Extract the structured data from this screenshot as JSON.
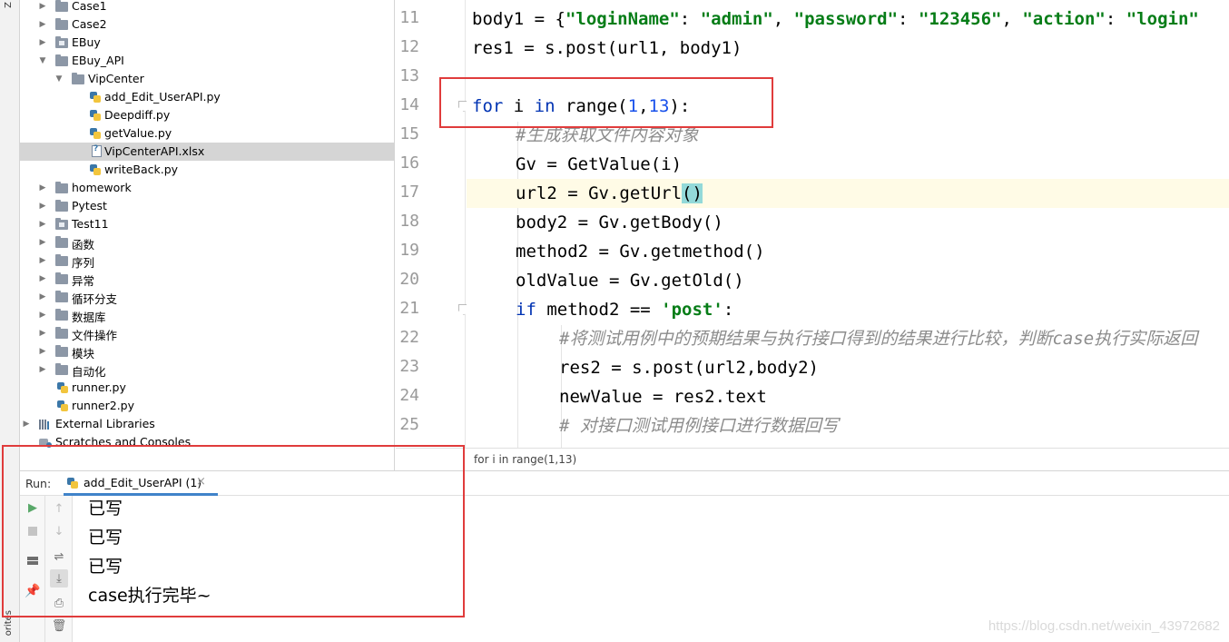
{
  "sidebar_strip": {
    "top_label": "Z",
    "bottom_label": "orites"
  },
  "project_tree": {
    "items": [
      {
        "label": "Case1",
        "type": "folder",
        "expanded": false,
        "depth": 1
      },
      {
        "label": "Case2",
        "type": "folder",
        "expanded": false,
        "depth": 1
      },
      {
        "label": "EBuy",
        "type": "package",
        "expanded": false,
        "depth": 1
      },
      {
        "label": "EBuy_API",
        "type": "folder",
        "expanded": true,
        "depth": 1
      },
      {
        "label": "VipCenter",
        "type": "folder",
        "expanded": true,
        "depth": 2
      },
      {
        "label": "add_Edit_UserAPI.py",
        "type": "python",
        "depth": 3
      },
      {
        "label": "Deepdiff.py",
        "type": "python",
        "depth": 3
      },
      {
        "label": "getValue.py",
        "type": "python",
        "depth": 3
      },
      {
        "label": "VipCenterAPI.xlsx",
        "type": "xlsx",
        "depth": 3,
        "selected": true
      },
      {
        "label": "writeBack.py",
        "type": "python",
        "depth": 3
      },
      {
        "label": "homework",
        "type": "folder",
        "expanded": false,
        "depth": 1
      },
      {
        "label": "Pytest",
        "type": "folder",
        "expanded": false,
        "depth": 1
      },
      {
        "label": "Test11",
        "type": "package",
        "expanded": false,
        "depth": 1
      },
      {
        "label": "函数",
        "type": "folder",
        "expanded": false,
        "depth": 1
      },
      {
        "label": "序列",
        "type": "folder",
        "expanded": false,
        "depth": 1
      },
      {
        "label": "异常",
        "type": "folder",
        "expanded": false,
        "depth": 1
      },
      {
        "label": "循环分支",
        "type": "folder",
        "expanded": false,
        "depth": 1
      },
      {
        "label": "数据库",
        "type": "folder",
        "expanded": false,
        "depth": 1
      },
      {
        "label": "文件操作",
        "type": "folder",
        "expanded": false,
        "depth": 1
      },
      {
        "label": "模块",
        "type": "folder",
        "expanded": false,
        "depth": 1
      },
      {
        "label": "自动化",
        "type": "folder",
        "expanded": false,
        "depth": 1
      },
      {
        "label": "runner.py",
        "type": "python",
        "depth": 1
      },
      {
        "label": "runner2.py",
        "type": "python",
        "depth": 1
      },
      {
        "label": "External Libraries",
        "type": "library",
        "expanded": false,
        "depth": 0
      },
      {
        "label": "Scratches and Consoles",
        "type": "scratch",
        "depth": 0
      }
    ]
  },
  "editor": {
    "line_numbers": [
      "11",
      "12",
      "13",
      "14",
      "15",
      "16",
      "17",
      "18",
      "19",
      "20",
      "21",
      "22",
      "23",
      "24",
      "25"
    ],
    "current_line": "17",
    "lines": {
      "l11": {
        "a": "body1 = {",
        "k1": "\"loginName\"",
        "b": ": ",
        "v1": "\"admin\"",
        "c": ", ",
        "k2": "\"password\"",
        "d": ": ",
        "v2": "\"123456\"",
        "e": ", ",
        "k3": "\"action\"",
        "f": ": ",
        "v3": "\"login\""
      },
      "l12": {
        "a": "res1 = s.post(url1, body1)"
      },
      "l13": {
        "a": ""
      },
      "l14": {
        "kw1": "for",
        "a": " i ",
        "kw2": "in",
        "b": " range(",
        "n1": "1",
        "c": ",",
        "n2": "13",
        "d": "):"
      },
      "l15": {
        "cmt": "#生成获取文件内容对象"
      },
      "l16": {
        "a": "Gv = GetValue(i)"
      },
      "l17": {
        "a": "url2 = Gv.getUrl",
        "hl": "()"
      },
      "l18": {
        "a": "body2 = Gv.getBody()"
      },
      "l19": {
        "a": "method2 = Gv.getmethod()"
      },
      "l20": {
        "a": "oldValue = Gv.getOld()"
      },
      "l21": {
        "kw": "if",
        "a": " method2 == ",
        "s": "'post'",
        "b": ":"
      },
      "l22": {
        "cmt": "#将测试用例中的预期结果与执行接口得到的结果进行比较，判断case执行实际返回"
      },
      "l23": {
        "a": "res2 = s.post(url2,body2)"
      },
      "l24": {
        "a": "newValue = res2.text"
      },
      "l25": {
        "cmt": "# 对接口测试用例接口进行数据回写"
      }
    }
  },
  "breadcrumb": {
    "text": "for i in range(1,13)"
  },
  "run_panel": {
    "title": "Run:",
    "tab_label": "add_Edit_UserAPI (1)",
    "tab_close": "×",
    "console_lines": [
      "已写",
      "已写",
      "已写",
      "case执行完毕~"
    ]
  },
  "watermark": "https://blog.csdn.net/weixin_43972682",
  "colors": {
    "keyword": "#0033b3",
    "string": "#067d17",
    "number": "#1750eb",
    "comment": "#8c8c8c",
    "annotation_red": "#e03c3c",
    "current_line_bg": "#fffbe6",
    "paren_highlight": "#93d9d9"
  }
}
